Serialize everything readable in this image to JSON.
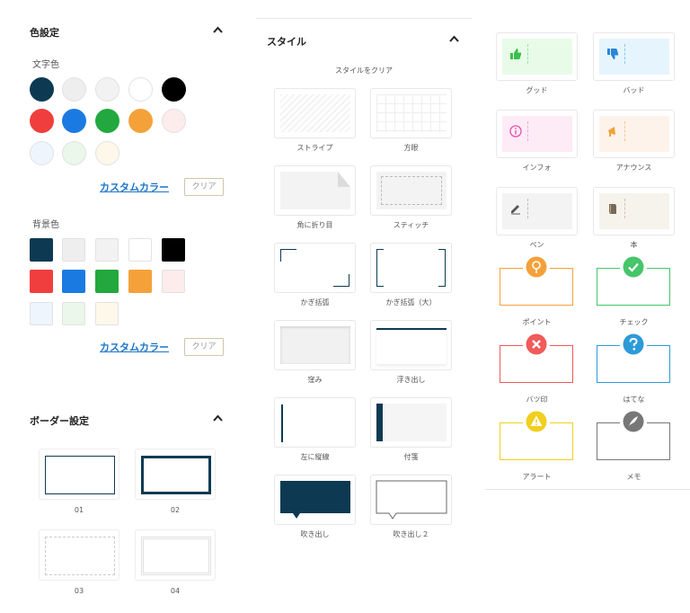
{
  "color_settings": {
    "title": "色設定",
    "text_color_label": "文字色",
    "bg_color_label": "背景色",
    "custom_color_label": "カスタムカラー",
    "clear_label": "クリア",
    "text_swatches": [
      "#0d3a52",
      "#eeeeee",
      "#f2f2f2",
      "#ffffff",
      "#000000",
      "#f03e3e",
      "#1a7ae2",
      "#22a83e",
      "#f5a13a",
      "#fdecec",
      "#eef5fc",
      "#eaf7ea",
      "#fdf8ea"
    ],
    "bg_swatches": [
      "#0d3a52",
      "#eeeeee",
      "#f2f2f2",
      "#ffffff",
      "#000000",
      "#f03e3e",
      "#1a7ae2",
      "#22a83e",
      "#f5a13a",
      "#fdecec",
      "#eef5fc",
      "#eaf7ea",
      "#fdf8ea"
    ]
  },
  "border_settings": {
    "title": "ボーダー設定",
    "options": [
      "01",
      "02",
      "03",
      "04"
    ]
  },
  "style_panel": {
    "title": "スタイル",
    "clear_style_label": "スタイルをクリア",
    "styles": [
      "ストライプ",
      "方眼",
      "角に折り目",
      "スティッチ",
      "かぎ括弧",
      "かぎ括弧（大）",
      "窪み",
      "浮き出し",
      "左に縦線",
      "付箋",
      "吹き出し",
      "吹き出し２"
    ]
  },
  "box_styles": {
    "items": [
      "グッド",
      "バッド",
      "インフォ",
      "アナウンス",
      "ペン",
      "本",
      "ポイント",
      "チェック",
      "バツ印",
      "はてな",
      "アラート",
      "メモ"
    ],
    "colors": {
      "good": "#3bbf4a",
      "bad": "#2a86d8",
      "info": "#e84fb0",
      "announce": "#f0a23a",
      "pen": "#555555",
      "book": "#7a6a55",
      "point": "#f5a13a",
      "check": "#46c56a",
      "cross": "#f05a5a",
      "question": "#2b9bd8",
      "alert": "#f2cf1e",
      "memo": "#777777"
    }
  }
}
